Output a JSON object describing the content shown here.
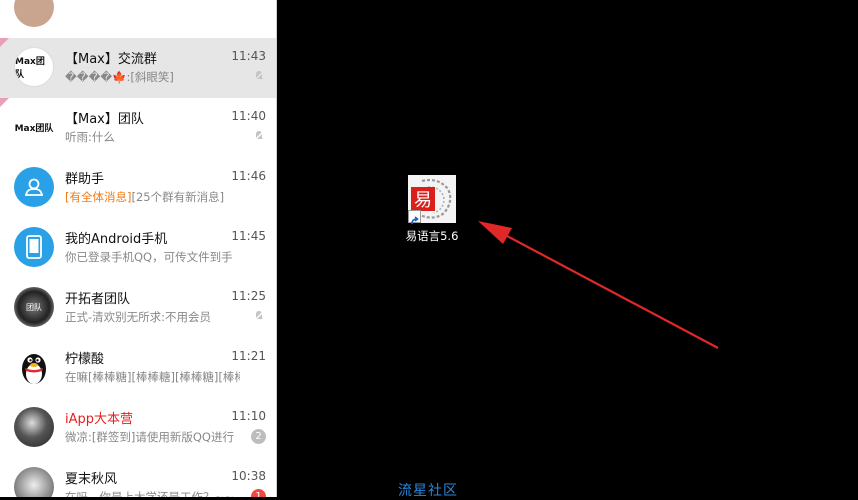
{
  "chat_list": [
    {
      "name": "",
      "time": "",
      "preview": "",
      "avatar": "partial-avatar-icon"
    },
    {
      "name": "【Max】交流群",
      "time": "11:43",
      "preview": "����🍁:[斜眼笑]",
      "muted": true,
      "selected": true,
      "pinned": true,
      "avatar_text": "Max团队"
    },
    {
      "name": "【Max】团队",
      "time": "11:40",
      "preview": "听雨:什么",
      "muted": true,
      "pinned": true,
      "avatar_text": "Max团队"
    },
    {
      "name": "群助手",
      "time": "11:46",
      "preview_highlight": "[有全体消息]",
      "preview": "[25个群有新消息]",
      "avatar": "group-assistant-icon"
    },
    {
      "name": "我的Android手机",
      "time": "11:45",
      "preview": "你已登录手机QQ，可传文件到手",
      "avatar": "phone-icon"
    },
    {
      "name": "开拓者团队",
      "time": "11:25",
      "preview": "正式-清欢别无所求:不用会员",
      "muted": true,
      "avatar_text": "团队"
    },
    {
      "name": "柠檬酸",
      "time": "11:21",
      "preview": "在嘛[棒棒糖][棒棒糖][棒棒糖][棒棒",
      "avatar": "penguin-icon"
    },
    {
      "name": "iApp大本营",
      "time": "11:10",
      "preview": "微凉:[群签到]请使用新版QQ进行",
      "badge": "2",
      "name_color": "#e52020"
    },
    {
      "name": "夏末秋风",
      "time": "10:38",
      "preview": "在吗，你是上大学还是工作？~~",
      "badge": "1"
    }
  ],
  "desktop": {
    "icon_label": "易语言5.6",
    "icon_glyph": "易",
    "watermark": "流星社区"
  },
  "colors": {
    "accent_blue": "#2aa0e6",
    "unread_red": "#f04a3e",
    "arrow_red": "#e02828"
  }
}
